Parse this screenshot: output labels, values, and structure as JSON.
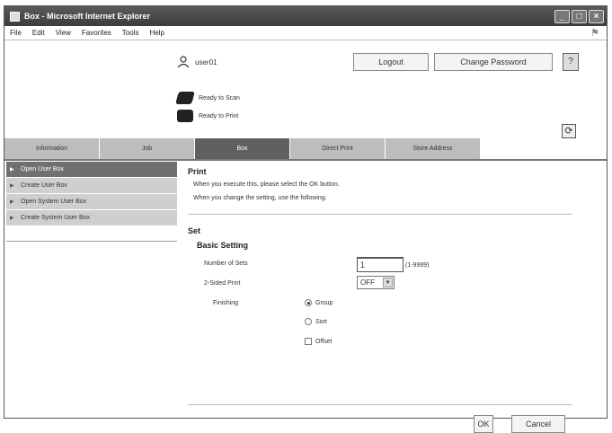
{
  "window": {
    "title": "Box - Microsoft Internet Explorer"
  },
  "menu": [
    "File",
    "Edit",
    "View",
    "Favorites",
    "Tools",
    "Help"
  ],
  "header": {
    "user": "user01",
    "logout": "Logout",
    "change_password": "Change Password",
    "help": "?"
  },
  "status": {
    "scan": "Ready to Scan",
    "print": "Ready to Print"
  },
  "tabs": [
    "Information",
    "Job",
    "Box",
    "Direct Print",
    "Store Address"
  ],
  "sidebar": [
    "Open User Box",
    "Create User Box",
    "Open System User Box",
    "Create System User Box"
  ],
  "main": {
    "print_heading": "Print",
    "desc1": "When you execute this, please select the OK button.",
    "desc2": "When you change the setting, use the following.",
    "set_heading": "Set",
    "basic_heading": "Basic Setting",
    "sets_label": "Number of Sets",
    "sets_value": "1",
    "sets_range": "(1-9999)",
    "sided_label": "2-Sided Print",
    "sided_value": "OFF",
    "finishing_label": "Finishing",
    "opt_group": "Group",
    "opt_sort": "Sort",
    "opt_offset": "Offset"
  },
  "buttons": {
    "ok": "OK",
    "cancel": "Cancel"
  }
}
